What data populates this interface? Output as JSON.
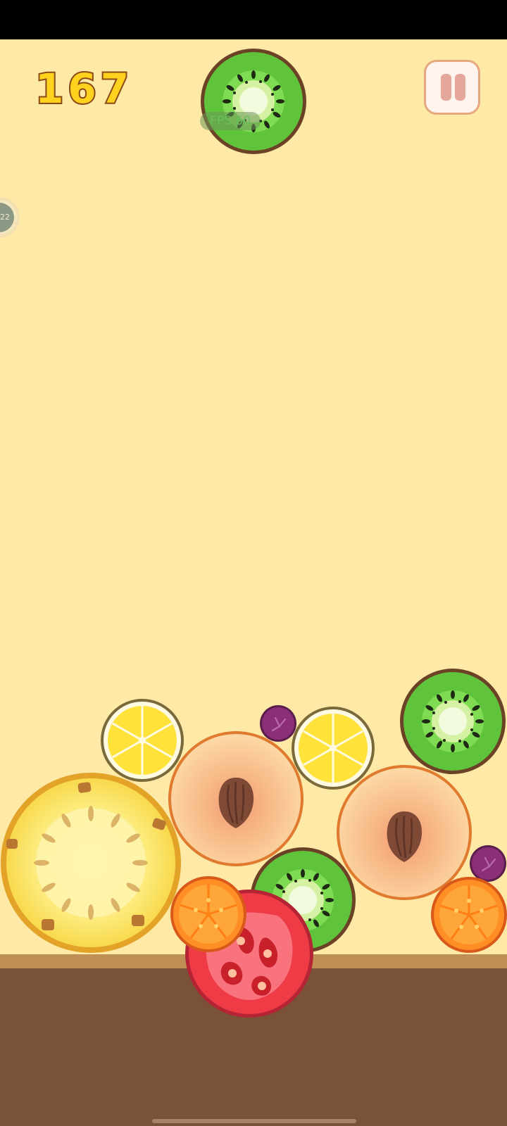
{
  "game": {
    "score": "167",
    "fps_label": "FPS 60",
    "side_badge_label": "22"
  },
  "next_fruit": "kiwi",
  "board_fruits": [
    "pineapple",
    "lemon",
    "peach",
    "grape",
    "lemon",
    "kiwi",
    "peach",
    "grape",
    "kiwi",
    "orange",
    "tomato",
    "orange"
  ],
  "colors": {
    "background": "#FEE9A6",
    "ground": "#7A5238",
    "score_fill": "#FFD21E",
    "score_outline": "#8A4A17"
  }
}
